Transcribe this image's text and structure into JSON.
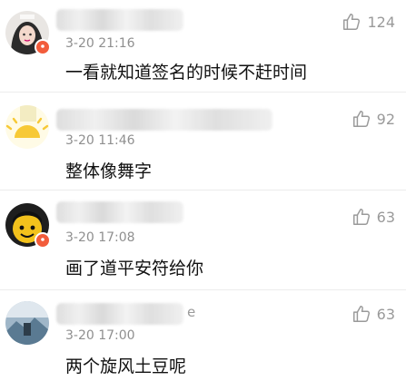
{
  "comments": [
    {
      "username_tail": "",
      "time": "3-20 21:16",
      "text": "一看就知道签名的时候不赶时间",
      "likes": "124",
      "avatar_icon": "girl-avatar-icon"
    },
    {
      "username_tail": "",
      "time": "3-20 11:46",
      "text": "整体像舞字",
      "likes": "92",
      "avatar_icon": "sun-avatar-icon"
    },
    {
      "username_tail": "",
      "time": "3-20 17:08",
      "text": "画了道平安符给你",
      "likes": "63",
      "avatar_icon": "cartoon-face-avatar-icon"
    },
    {
      "username_tail": "e",
      "time": "3-20 17:00",
      "text": "两个旋风土豆呢",
      "likes": "63",
      "avatar_icon": "photo-avatar-icon"
    }
  ],
  "colors": {
    "badge": "#f25c3b",
    "meta": "#8f8f8f",
    "text": "#111111"
  },
  "icons": {
    "like": "thumbs-up-icon"
  }
}
